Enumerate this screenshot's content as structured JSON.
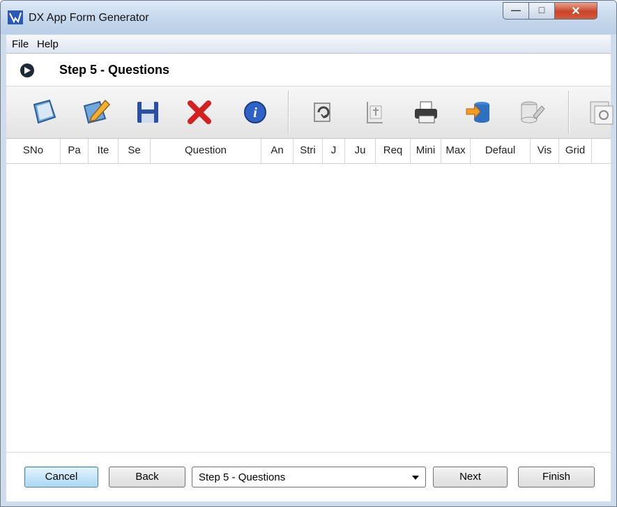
{
  "window": {
    "title": "DX App Form Generator",
    "minimize_glyph": "—",
    "maximize_glyph": "□",
    "close_glyph": "✕"
  },
  "menu": {
    "items": [
      "File",
      "Help"
    ]
  },
  "step": {
    "title": "Step 5 - Questions"
  },
  "toolbar": {
    "buttons": [
      "new-icon",
      "edit-icon",
      "save-icon",
      "delete-icon",
      "info-icon",
      "refresh-icon",
      "import-icon",
      "print-icon",
      "database-export-icon",
      "database-edit-icon",
      "report-icon"
    ]
  },
  "grid": {
    "columns": [
      "SNo",
      "Pa",
      "Ite",
      "Se",
      "Question",
      "An",
      "Stri",
      "J",
      "Ju",
      "Req",
      "Mini",
      "Max",
      "Defaul",
      "Vis",
      "Grid"
    ],
    "rows": []
  },
  "footer": {
    "cancel_label": "Cancel",
    "back_label": "Back",
    "step_select_value": "Step 5 - Questions",
    "next_label": "Next",
    "finish_label": "Finish"
  },
  "colors": {
    "title_bar": "#c3d6eb",
    "close_button": "#c8442a",
    "default_button": "#a9d7f2"
  }
}
